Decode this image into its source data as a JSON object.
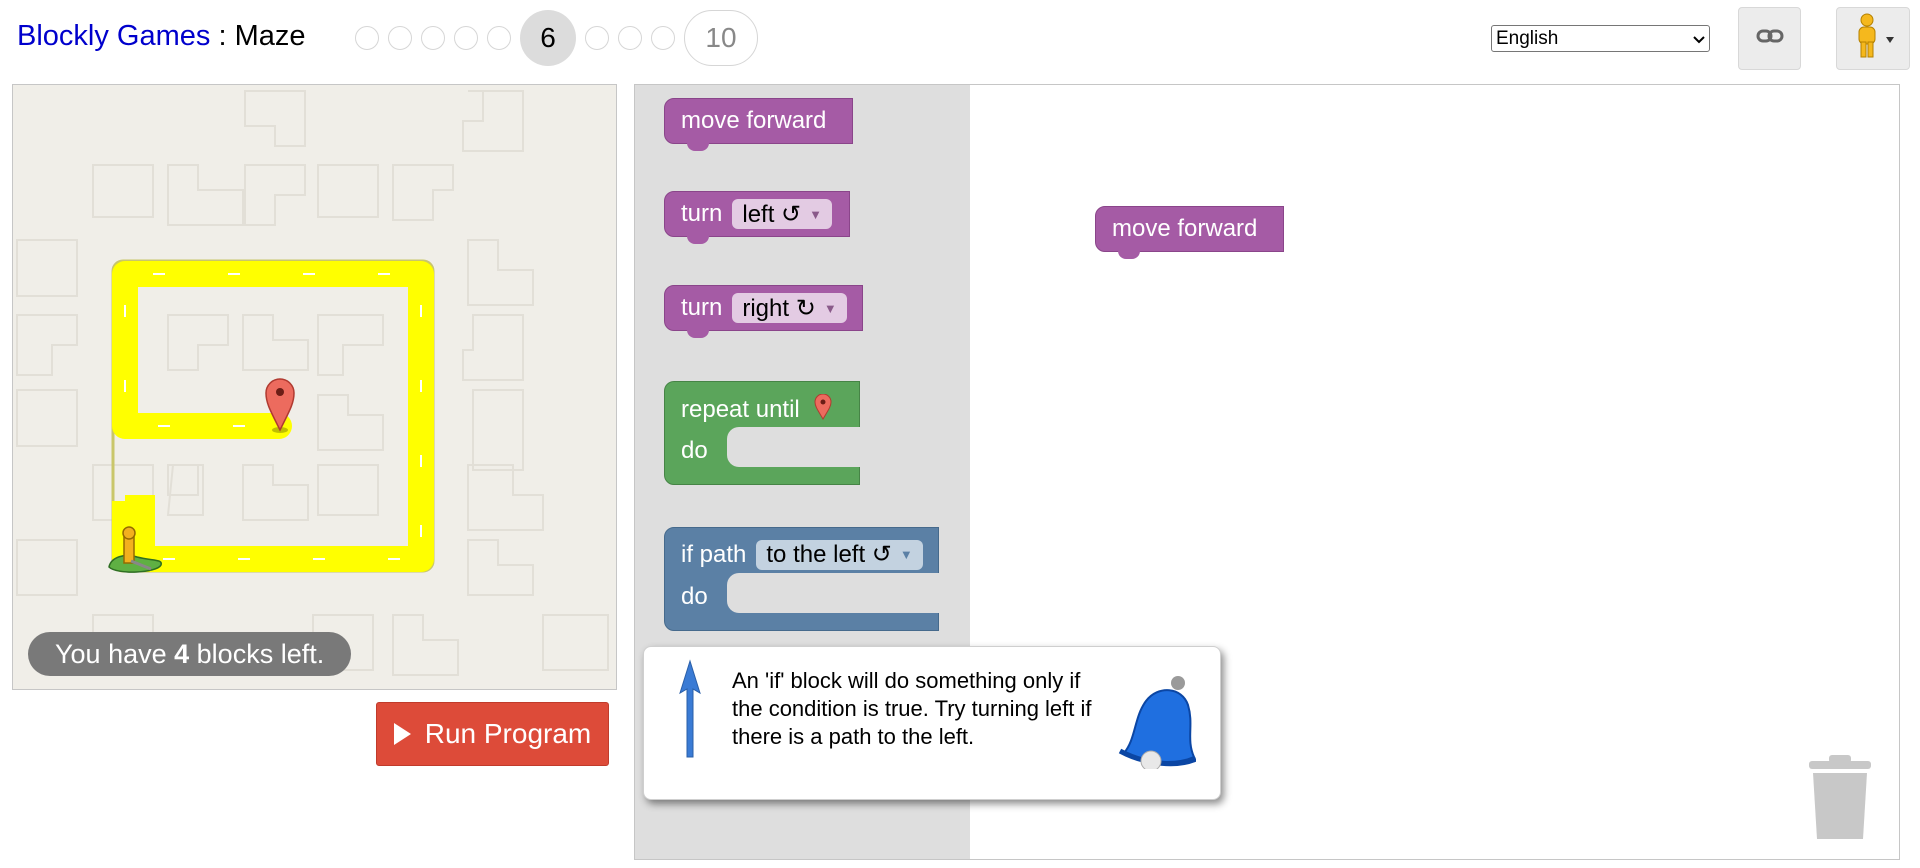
{
  "header": {
    "site_title": "Blockly Games",
    "separator": " : ",
    "game_name": "Maze",
    "levels": [
      "",
      "",
      "",
      "",
      "",
      "6",
      "",
      "",
      "",
      "10"
    ],
    "current_level": "6",
    "last_level": "10",
    "language": "English"
  },
  "icons": {
    "link": "link-icon",
    "pegman": "pegman-icon",
    "dropdown": "chevron-down-icon",
    "start": "start-flag-icon",
    "finish": "map-marker-icon",
    "tip": "bell-icon",
    "arrow": "arrow-up-icon",
    "trash": "trash-icon",
    "play": "play-icon"
  },
  "maze": {
    "capacity_prefix": "You have ",
    "capacity_count": "4",
    "capacity_suffix": " blocks left.",
    "run_label": "Run Program"
  },
  "toolbox": {
    "move_forward": "move forward",
    "turn_left": {
      "keyword": "turn",
      "value": "left ↺"
    },
    "turn_right": {
      "keyword": "turn",
      "value": "right ↻"
    },
    "repeat_until": {
      "keyword": "repeat until",
      "do": "do"
    },
    "if_path": {
      "keyword": "if path",
      "value": "to the left ↺",
      "do": "do"
    }
  },
  "workspace": {
    "placed_block": "move forward"
  },
  "tip": {
    "text": "An 'if' block will do something only if the condition is true. Try turning left if there is a path to the left."
  },
  "colors": {
    "motion_block": "#a55ba5",
    "loop_block": "#5ba55b",
    "logic_block": "#5b80a5",
    "path": "#ffff00",
    "run_button": "#dd4b39",
    "title_link": "#0000cc"
  }
}
